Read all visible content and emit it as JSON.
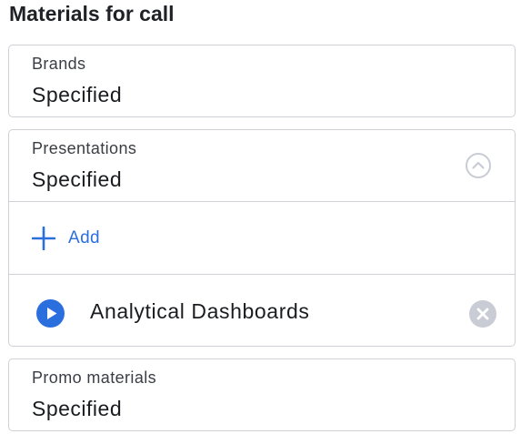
{
  "page": {
    "title": "Materials for call"
  },
  "brands": {
    "label": "Brands",
    "value": "Specified"
  },
  "presentations": {
    "label": "Presentations",
    "value": "Specified",
    "expanded": true,
    "add_label": "Add",
    "items": [
      {
        "label": "Analytical Dashboards"
      }
    ]
  },
  "promo": {
    "label": "Promo materials",
    "value": "Specified"
  },
  "icons": {
    "collapse": "chevron-up-circle-icon",
    "add": "plus-icon",
    "play": "play-circle-icon",
    "remove": "close-circle-icon"
  },
  "colors": {
    "accent": "#2b6fdf",
    "border": "#cfd1d8",
    "muted_icon": "#c9ccd4",
    "text": "#1a1c20"
  }
}
